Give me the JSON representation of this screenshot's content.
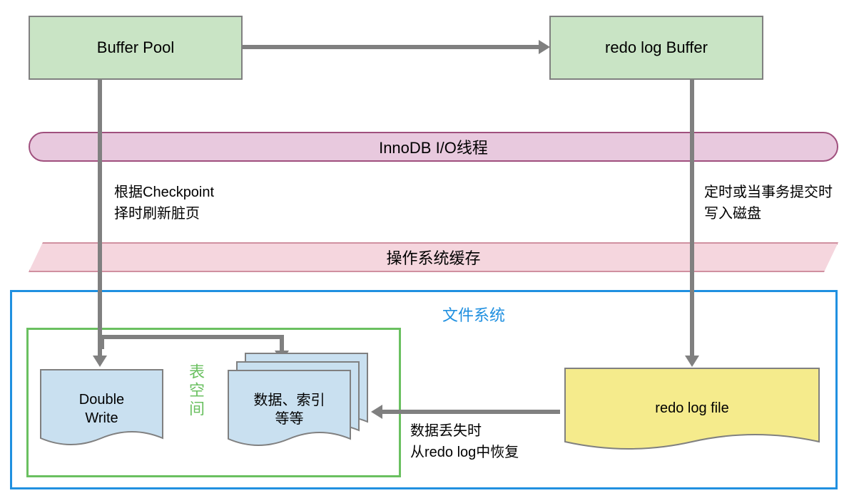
{
  "boxes": {
    "buffer_pool": "Buffer Pool",
    "redo_buffer": "redo log Buffer",
    "innodb_threads": "InnoDB I/O线程",
    "os_cache": "操作系统缓存",
    "file_system": "文件系统",
    "tablespace": "表空间",
    "double_write": "Double Write",
    "data_index": "数据、索引等等",
    "redo_log_file": "redo log file"
  },
  "labels": {
    "checkpoint": "根据Checkpoint\n择时刷新脏页",
    "checkpoint_l1": "根据Checkpoint",
    "checkpoint_l2": "择时刷新脏页",
    "commit_l1": "定时或当事务提交时",
    "commit_l2": "写入磁盘",
    "recover_l1": "数据丢失时",
    "recover_l2": "从redo log中恢复"
  },
  "colors": {
    "green_fill": "#c9e4c5",
    "pink_fill": "#e8c9de",
    "light_pink_fill": "#f5d6de",
    "blue_fill": "#c9e0f0",
    "yellow_fill": "#f5eb8c",
    "gray_border": "#808080",
    "blue_border": "#2090e0",
    "green_border": "#6ac060"
  }
}
